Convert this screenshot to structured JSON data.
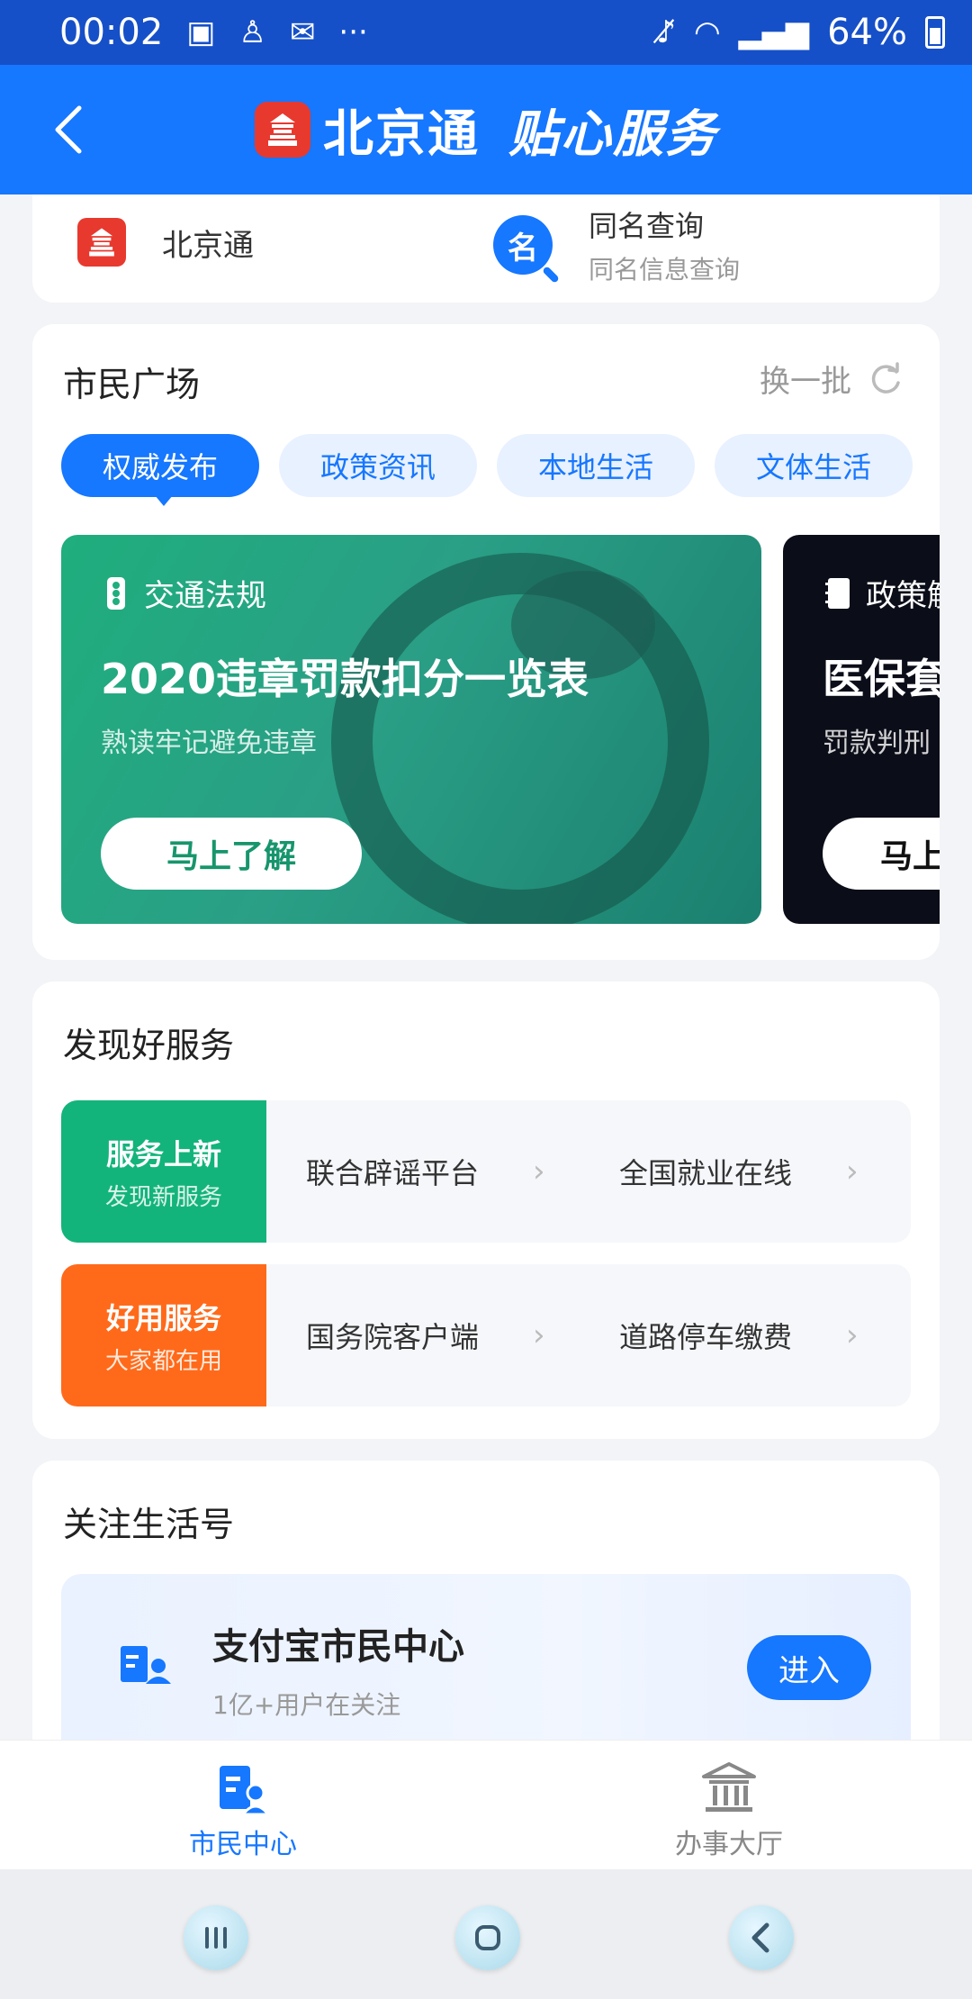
{
  "status_bar": {
    "time": "00:02",
    "icons": [
      "gallery-icon",
      "notification-icon",
      "mail-icon",
      "more-dots-icon"
    ],
    "battery": "64%",
    "right_icons": [
      "mute-icon",
      "wifi-icon",
      "signal-icon",
      "battery-icon"
    ]
  },
  "header": {
    "title": "北京通",
    "slogan": "贴心服务",
    "accent": "#1677ff"
  },
  "top_card": {
    "app_name": "北京通",
    "service_icon_char": "名",
    "service_title": "同名查询",
    "service_subtitle": "同名信息查询"
  },
  "plaza": {
    "title": "市民广场",
    "refresh_label": "换一批",
    "tabs": [
      {
        "label": "权威发布",
        "active": true
      },
      {
        "label": "政策资讯",
        "active": false
      },
      {
        "label": "本地生活",
        "active": false
      },
      {
        "label": "文体生活",
        "active": false
      }
    ],
    "banners": [
      {
        "category": "交通法规",
        "title": "2020违章罚款扣分一览表",
        "subtitle": "熟读牢记避免违章",
        "button": "马上了解"
      },
      {
        "category": "政策解",
        "title": "医保套",
        "subtitle": "罚款判刑",
        "button": "马上"
      }
    ]
  },
  "discover": {
    "title": "发现好服务",
    "rows": [
      {
        "tag_title": "服务上新",
        "tag_subtitle": "发现新服务",
        "links": [
          "联合辟谣平台",
          "全国就业在线"
        ]
      },
      {
        "tag_title": "好用服务",
        "tag_subtitle": "大家都在用",
        "links": [
          "国务院客户端",
          "道路停车缴费"
        ]
      }
    ]
  },
  "life": {
    "title": "关注生活号",
    "account_name": "支付宝市民中心",
    "followers": "1亿+用户在关注",
    "enter_button": "进入"
  },
  "bottom_nav": {
    "items": [
      {
        "label": "市民中心",
        "icon": "citizen-center-icon",
        "active": true
      },
      {
        "label": "办事大厅",
        "icon": "government-hall-icon",
        "active": false
      }
    ]
  },
  "system_nav": {
    "buttons": [
      "recent-apps-icon",
      "home-icon",
      "back-icon"
    ]
  }
}
